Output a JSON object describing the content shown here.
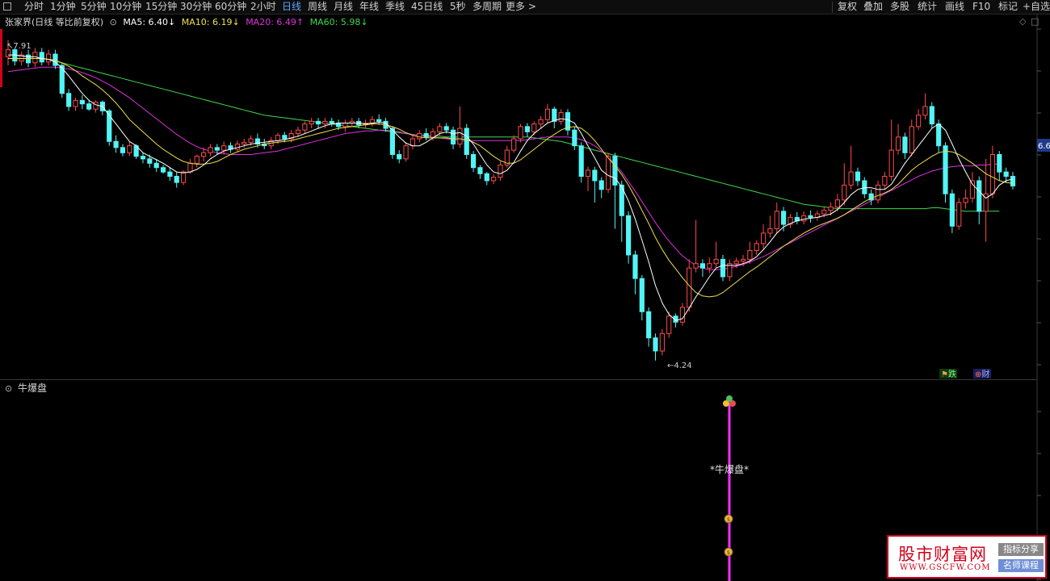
{
  "toolbar": {
    "periods": [
      "分时",
      "1分钟",
      "5分钟",
      "10分钟",
      "15分钟",
      "30分钟",
      "60分钟",
      "2小时",
      "日线",
      "周线",
      "月线",
      "年线",
      "季线",
      "45日线",
      "5秒",
      "多周期",
      "更多 >"
    ],
    "active_period": "日线",
    "right_buttons": [
      "复权",
      "叠加",
      "多股",
      "统计",
      "画线",
      "F10",
      "标记",
      "+自选"
    ]
  },
  "legend": {
    "title": "张家界(日线 等比前复权)",
    "ma5": "MA5: 6.40↓",
    "ma10": "MA10: 6.19↓",
    "ma20": "MA20: 6.49↑",
    "ma60": "MA60: 5.98↓"
  },
  "colors": {
    "up": "#ff4a4a",
    "down": "#52f5f5",
    "ma5": "#ffffff",
    "ma10": "#f0e04a",
    "ma20": "#e030e0",
    "ma60": "#3fd94b",
    "indicator": "#ff2bff"
  },
  "price": {
    "high_label": "7.91",
    "low_label": "4.24",
    "right_label": "6.6"
  },
  "badges": {
    "b1": "跌",
    "b2": "财"
  },
  "indicator": {
    "name": "牛爆盘",
    "signal_label": "*牛爆盘*"
  },
  "watermark": {
    "title": "股市财富网",
    "url": "WWW.GSCFW.COM",
    "tag1": "指标分享",
    "tag2": "名师课程"
  },
  "chart_data": {
    "type": "candlestick",
    "ylim": [
      4.1,
      8.0
    ],
    "candles": [
      [
        7.72,
        7.8,
        7.62,
        7.91
      ],
      [
        7.8,
        7.67,
        7.62,
        7.82
      ],
      [
        7.67,
        7.74,
        7.62,
        7.78
      ],
      [
        7.74,
        7.65,
        7.6,
        7.8
      ],
      [
        7.65,
        7.77,
        7.6,
        7.82
      ],
      [
        7.77,
        7.66,
        7.62,
        7.82
      ],
      [
        7.66,
        7.75,
        7.62,
        7.8
      ],
      [
        7.75,
        7.62,
        7.58,
        7.8
      ],
      [
        7.62,
        7.3,
        7.25,
        7.65
      ],
      [
        7.3,
        7.15,
        7.1,
        7.35
      ],
      [
        7.15,
        7.22,
        7.1,
        7.25
      ],
      [
        7.22,
        7.18,
        7.12,
        7.28
      ],
      [
        7.18,
        7.12,
        7.1,
        7.22
      ],
      [
        7.12,
        7.2,
        7.08,
        7.22
      ],
      [
        7.2,
        7.1,
        7.05,
        7.22
      ],
      [
        7.1,
        6.75,
        6.7,
        7.12
      ],
      [
        6.75,
        6.68,
        6.62,
        6.82
      ],
      [
        6.68,
        6.62,
        6.58,
        6.72
      ],
      [
        6.62,
        6.7,
        6.58,
        6.75
      ],
      [
        6.7,
        6.58,
        6.55,
        6.72
      ],
      [
        6.58,
        6.55,
        6.5,
        6.62
      ],
      [
        6.55,
        6.5,
        6.45,
        6.6
      ],
      [
        6.5,
        6.45,
        6.4,
        6.55
      ],
      [
        6.45,
        6.4,
        6.38,
        6.48
      ],
      [
        6.4,
        6.35,
        6.3,
        6.45
      ],
      [
        6.35,
        6.28,
        6.22,
        6.4
      ],
      [
        6.28,
        6.4,
        6.25,
        6.42
      ],
      [
        6.4,
        6.5,
        6.38,
        6.55
      ],
      [
        6.5,
        6.58,
        6.45,
        6.6
      ],
      [
        6.58,
        6.62,
        6.52,
        6.68
      ],
      [
        6.62,
        6.68,
        6.58,
        6.72
      ],
      [
        6.68,
        6.65,
        6.6,
        6.72
      ],
      [
        6.65,
        6.7,
        6.6,
        6.75
      ],
      [
        6.7,
        6.66,
        6.62,
        6.74
      ],
      [
        6.66,
        6.72,
        6.62,
        6.76
      ],
      [
        6.72,
        6.74,
        6.68,
        6.78
      ],
      [
        6.74,
        6.78,
        6.7,
        6.82
      ],
      [
        6.78,
        6.72,
        6.68,
        6.84
      ],
      [
        6.72,
        6.7,
        6.66,
        6.78
      ],
      [
        6.7,
        6.76,
        6.66,
        6.8
      ],
      [
        6.76,
        6.82,
        6.72,
        6.85
      ],
      [
        6.82,
        6.78,
        6.74,
        6.86
      ],
      [
        6.78,
        6.84,
        6.74,
        6.88
      ],
      [
        6.84,
        6.88,
        6.8,
        6.92
      ],
      [
        6.88,
        6.95,
        6.84,
        6.98
      ],
      [
        6.95,
        6.98,
        6.9,
        7.02
      ],
      [
        6.98,
        6.95,
        6.9,
        7.02
      ],
      [
        6.95,
        6.98,
        6.9,
        7.02
      ],
      [
        6.98,
        6.96,
        6.92,
        7.02
      ],
      [
        6.96,
        6.92,
        6.88,
        7.0
      ],
      [
        6.92,
        6.96,
        6.86,
        7.0
      ],
      [
        6.96,
        6.98,
        6.92,
        7.02
      ],
      [
        6.98,
        6.94,
        6.9,
        7.02
      ],
      [
        6.94,
        6.96,
        6.9,
        7.0
      ],
      [
        6.96,
        7.0,
        6.92,
        7.04
      ],
      [
        7.0,
        6.98,
        6.94,
        7.06
      ],
      [
        6.98,
        6.9,
        6.86,
        7.02
      ],
      [
        6.9,
        6.6,
        6.55,
        6.92
      ],
      [
        6.6,
        6.55,
        6.5,
        6.65
      ],
      [
        6.55,
        6.7,
        6.52,
        6.74
      ],
      [
        6.7,
        6.78,
        6.66,
        6.82
      ],
      [
        6.78,
        6.84,
        6.74,
        6.88
      ],
      [
        6.84,
        6.8,
        6.76,
        6.9
      ],
      [
        6.8,
        6.86,
        6.76,
        6.9
      ],
      [
        6.86,
        6.92,
        6.82,
        6.96
      ],
      [
        6.92,
        6.88,
        6.84,
        6.96
      ],
      [
        6.88,
        6.72,
        6.66,
        6.92
      ],
      [
        6.72,
        6.9,
        6.68,
        7.15
      ],
      [
        6.9,
        6.6,
        6.55,
        6.95
      ],
      [
        6.6,
        6.45,
        6.4,
        6.64
      ],
      [
        6.45,
        6.38,
        6.32,
        6.48
      ],
      [
        6.38,
        6.3,
        6.25,
        6.4
      ],
      [
        6.3,
        6.34,
        6.26,
        6.38
      ],
      [
        6.34,
        6.48,
        6.3,
        6.52
      ],
      [
        6.48,
        6.65,
        6.45,
        6.7
      ],
      [
        6.65,
        6.78,
        6.62,
        6.82
      ],
      [
        6.78,
        6.92,
        6.74,
        6.95
      ],
      [
        6.92,
        6.86,
        6.8,
        6.96
      ],
      [
        6.86,
        6.95,
        6.82,
        6.98
      ],
      [
        6.95,
        7.0,
        6.9,
        7.04
      ],
      [
        7.0,
        7.12,
        6.96,
        7.18
      ],
      [
        7.12,
        6.98,
        6.9,
        7.15
      ],
      [
        6.98,
        7.08,
        6.94,
        7.12
      ],
      [
        7.08,
        6.88,
        6.82,
        7.12
      ],
      [
        6.88,
        6.7,
        6.65,
        6.92
      ],
      [
        6.7,
        6.35,
        6.28,
        6.74
      ],
      [
        6.35,
        6.42,
        6.18,
        6.46
      ],
      [
        6.42,
        6.3,
        6.05,
        6.46
      ],
      [
        6.3,
        6.2,
        6.1,
        6.34
      ],
      [
        6.2,
        6.58,
        6.16,
        6.62
      ],
      [
        6.58,
        6.25,
        5.75,
        6.62
      ],
      [
        6.25,
        5.9,
        5.6,
        6.3
      ],
      [
        5.9,
        5.45,
        5.35,
        5.95
      ],
      [
        5.45,
        5.18,
        5.0,
        5.5
      ],
      [
        5.18,
        4.8,
        4.7,
        5.22
      ],
      [
        4.8,
        4.5,
        4.4,
        4.85
      ],
      [
        4.5,
        4.35,
        4.24,
        4.55
      ],
      [
        4.35,
        4.55,
        4.3,
        4.6
      ],
      [
        4.55,
        4.75,
        4.5,
        4.8
      ],
      [
        4.75,
        4.68,
        4.62,
        4.78
      ],
      [
        4.68,
        4.85,
        4.64,
        4.9
      ],
      [
        4.85,
        5.3,
        4.8,
        5.4
      ],
      [
        5.3,
        5.35,
        5.25,
        5.85
      ],
      [
        5.35,
        5.3,
        5.2,
        5.4
      ],
      [
        5.3,
        5.35,
        5.24,
        5.42
      ],
      [
        5.35,
        5.4,
        5.3,
        5.6
      ],
      [
        5.4,
        5.2,
        5.15,
        5.45
      ],
      [
        5.2,
        5.35,
        5.15,
        5.4
      ],
      [
        5.35,
        5.38,
        5.3,
        5.42
      ],
      [
        5.38,
        5.4,
        5.32,
        5.45
      ],
      [
        5.4,
        5.5,
        5.35,
        5.6
      ],
      [
        5.5,
        5.58,
        5.45,
        5.62
      ],
      [
        5.58,
        5.7,
        5.52,
        5.8
      ],
      [
        5.7,
        5.75,
        5.65,
        5.9
      ],
      [
        5.75,
        5.95,
        5.7,
        6.05
      ],
      [
        5.95,
        5.8,
        5.72,
        6.0
      ],
      [
        5.8,
        5.88,
        5.76,
        5.92
      ],
      [
        5.88,
        5.84,
        5.8,
        5.94
      ],
      [
        5.84,
        5.9,
        5.8,
        5.95
      ],
      [
        5.9,
        5.88,
        5.82,
        5.96
      ],
      [
        5.88,
        5.92,
        5.84,
        5.96
      ],
      [
        5.92,
        5.96,
        5.88,
        6.0
      ],
      [
        5.96,
        6.0,
        5.9,
        6.05
      ],
      [
        6.0,
        6.08,
        5.95,
        6.15
      ],
      [
        6.08,
        6.25,
        6.02,
        6.5
      ],
      [
        6.25,
        6.4,
        6.2,
        6.7
      ],
      [
        6.4,
        6.3,
        6.24,
        6.45
      ],
      [
        6.3,
        6.15,
        6.1,
        6.34
      ],
      [
        6.15,
        6.08,
        6.02,
        6.2
      ],
      [
        6.08,
        6.25,
        6.04,
        6.3
      ],
      [
        6.25,
        6.35,
        6.2,
        6.4
      ],
      [
        6.35,
        6.65,
        6.3,
        7.0
      ],
      [
        6.65,
        6.8,
        6.6,
        6.95
      ],
      [
        6.8,
        6.62,
        6.55,
        6.85
      ],
      [
        6.62,
        6.92,
        6.58,
        7.0
      ],
      [
        6.92,
        7.05,
        6.88,
        7.12
      ],
      [
        7.05,
        7.15,
        7.0,
        7.3
      ],
      [
        7.15,
        6.95,
        6.9,
        7.2
      ],
      [
        6.95,
        6.7,
        6.62,
        7.0
      ],
      [
        6.7,
        6.15,
        6.05,
        6.74
      ],
      [
        6.15,
        5.78,
        5.7,
        6.2
      ],
      [
        5.78,
        6.05,
        5.74,
        6.1
      ],
      [
        6.05,
        6.1,
        5.98,
        6.2
      ],
      [
        6.1,
        6.3,
        6.05,
        6.4
      ],
      [
        6.3,
        5.95,
        5.8,
        6.35
      ],
      [
        5.95,
        6.15,
        5.6,
        6.55
      ],
      [
        6.15,
        6.6,
        6.1,
        6.7
      ],
      [
        6.6,
        6.4,
        6.3,
        6.64
      ],
      [
        6.4,
        6.35,
        6.28,
        6.45
      ],
      [
        6.35,
        6.24,
        6.2,
        6.4
      ]
    ],
    "ma5": [
      7.74,
      7.74,
      7.73,
      7.72,
      7.72,
      7.7,
      7.69,
      7.66,
      7.59,
      7.5,
      7.4,
      7.3,
      7.22,
      7.17,
      7.15,
      7.05,
      6.95,
      6.85,
      6.75,
      6.7,
      6.62,
      6.58,
      6.54,
      6.5,
      6.45,
      6.4,
      6.39,
      6.4,
      6.43,
      6.48,
      6.55,
      6.6,
      6.64,
      6.66,
      6.68,
      6.7,
      6.72,
      6.73,
      6.74,
      6.75,
      6.76,
      6.77,
      6.79,
      6.81,
      6.84,
      6.87,
      6.9,
      6.93,
      6.95,
      6.96,
      6.96,
      6.96,
      6.96,
      6.95,
      6.96,
      6.97,
      6.96,
      6.88,
      6.8,
      6.73,
      6.7,
      6.7,
      6.74,
      6.79,
      6.84,
      6.86,
      6.84,
      6.85,
      6.81,
      6.72,
      6.6,
      6.48,
      6.4,
      6.38,
      6.42,
      6.51,
      6.64,
      6.76,
      6.84,
      6.9,
      6.96,
      6.99,
      7.01,
      7.0,
      6.96,
      6.84,
      6.7,
      6.56,
      6.42,
      6.36,
      6.33,
      6.23,
      6.07,
      5.86,
      5.62,
      5.37,
      5.1,
      4.9,
      4.77,
      4.7,
      4.72,
      4.84,
      4.97,
      5.08,
      5.2,
      5.3,
      5.33,
      5.33,
      5.33,
      5.35,
      5.38,
      5.43,
      5.51,
      5.6,
      5.7,
      5.77,
      5.81,
      5.84,
      5.86,
      5.87,
      5.88,
      5.9,
      5.92,
      5.97,
      6.05,
      6.14,
      6.2,
      6.22,
      6.22,
      6.2,
      6.2,
      6.26,
      6.38,
      6.5,
      6.6,
      6.7,
      6.8,
      6.9,
      6.95,
      6.88,
      6.72,
      6.55,
      6.4,
      6.26,
      6.18,
      6.1,
      6.15,
      6.25,
      6.3,
      6.32
    ],
    "ma10": [
      7.7,
      7.7,
      7.7,
      7.7,
      7.7,
      7.7,
      7.69,
      7.68,
      7.65,
      7.61,
      7.56,
      7.5,
      7.45,
      7.4,
      7.34,
      7.27,
      7.19,
      7.1,
      7.0,
      6.93,
      6.86,
      6.79,
      6.72,
      6.66,
      6.61,
      6.56,
      6.52,
      6.5,
      6.49,
      6.49,
      6.5,
      6.52,
      6.56,
      6.6,
      6.63,
      6.66,
      6.68,
      6.7,
      6.72,
      6.73,
      6.74,
      6.75,
      6.76,
      6.78,
      6.8,
      6.82,
      6.84,
      6.86,
      6.88,
      6.9,
      6.91,
      6.92,
      6.93,
      6.94,
      6.95,
      6.95,
      6.94,
      6.92,
      6.89,
      6.85,
      6.82,
      6.8,
      6.79,
      6.79,
      6.79,
      6.79,
      6.78,
      6.78,
      6.77,
      6.74,
      6.7,
      6.64,
      6.58,
      6.53,
      6.5,
      6.5,
      6.54,
      6.6,
      6.66,
      6.72,
      6.78,
      6.83,
      6.88,
      6.91,
      6.92,
      6.9,
      6.84,
      6.76,
      6.66,
      6.56,
      6.47,
      6.37,
      6.25,
      6.11,
      5.96,
      5.81,
      5.65,
      5.51,
      5.39,
      5.29,
      5.19,
      5.1,
      5.02,
      4.98,
      4.97,
      4.98,
      5.02,
      5.08,
      5.14,
      5.2,
      5.26,
      5.31,
      5.37,
      5.43,
      5.49,
      5.55,
      5.6,
      5.65,
      5.7,
      5.74,
      5.78,
      5.81,
      5.84,
      5.87,
      5.91,
      5.96,
      6.01,
      6.06,
      6.1,
      6.13,
      6.16,
      6.2,
      6.26,
      6.34,
      6.42,
      6.48,
      6.53,
      6.58,
      6.62,
      6.64,
      6.63,
      6.6,
      6.55,
      6.5,
      6.44,
      6.38,
      6.34,
      6.3,
      6.28,
      6.27
    ],
    "ma20": [
      7.55,
      7.56,
      7.57,
      7.58,
      7.59,
      7.6,
      7.6,
      7.6,
      7.59,
      7.58,
      7.56,
      7.54,
      7.51,
      7.48,
      7.44,
      7.4,
      7.35,
      7.3,
      7.25,
      7.19,
      7.13,
      7.07,
      7.01,
      6.95,
      6.89,
      6.83,
      6.78,
      6.73,
      6.69,
      6.66,
      6.64,
      6.62,
      6.61,
      6.6,
      6.6,
      6.6,
      6.6,
      6.61,
      6.62,
      6.63,
      6.64,
      6.66,
      6.68,
      6.7,
      6.72,
      6.74,
      6.76,
      6.78,
      6.8,
      6.82,
      6.84,
      6.85,
      6.86,
      6.87,
      6.87,
      6.88,
      6.88,
      6.87,
      6.86,
      6.84,
      6.83,
      6.82,
      6.81,
      6.8,
      6.79,
      6.78,
      6.77,
      6.76,
      6.76,
      6.76,
      6.76,
      6.76,
      6.76,
      6.76,
      6.76,
      6.76,
      6.76,
      6.77,
      6.78,
      6.79,
      6.8,
      6.8,
      6.8,
      6.8,
      6.79,
      6.77,
      6.74,
      6.7,
      6.64,
      6.57,
      6.49,
      6.4,
      6.29,
      6.18,
      6.06,
      5.94,
      5.82,
      5.71,
      5.61,
      5.52,
      5.44,
      5.38,
      5.33,
      5.3,
      5.28,
      5.28,
      5.29,
      5.3,
      5.32,
      5.34,
      5.37,
      5.4,
      5.43,
      5.47,
      5.51,
      5.55,
      5.59,
      5.63,
      5.67,
      5.71,
      5.75,
      5.79,
      5.83,
      5.87,
      5.91,
      5.95,
      5.99,
      6.03,
      6.07,
      6.11,
      6.15,
      6.19,
      6.23,
      6.27,
      6.31,
      6.35,
      6.38,
      6.41,
      6.43,
      6.45,
      6.46,
      6.47,
      6.47,
      6.47,
      6.48,
      6.48,
      6.49,
      6.49
    ],
    "ma60": [
      7.74,
      7.74,
      7.73,
      7.72,
      7.71,
      7.7,
      7.69,
      7.67,
      7.65,
      7.63,
      7.61,
      7.59,
      7.57,
      7.55,
      7.53,
      7.51,
      7.49,
      7.47,
      7.45,
      7.43,
      7.41,
      7.39,
      7.37,
      7.35,
      7.33,
      7.31,
      7.29,
      7.27,
      7.25,
      7.23,
      7.21,
      7.19,
      7.17,
      7.15,
      7.13,
      7.11,
      7.09,
      7.07,
      7.05,
      7.04,
      7.03,
      7.02,
      7.01,
      7.0,
      6.99,
      6.98,
      6.97,
      6.96,
      6.95,
      6.94,
      6.93,
      6.92,
      6.91,
      6.9,
      6.89,
      6.88,
      6.87,
      6.86,
      6.85,
      6.84,
      6.83,
      6.82,
      6.82,
      6.81,
      6.81,
      6.8,
      6.8,
      6.8,
      6.8,
      6.8,
      6.8,
      6.8,
      6.8,
      6.8,
      6.8,
      6.8,
      6.8,
      6.8,
      6.79,
      6.78,
      6.77,
      6.76,
      6.75,
      6.73,
      6.71,
      6.69,
      6.67,
      6.65,
      6.63,
      6.61,
      6.59,
      6.57,
      6.55,
      6.53,
      6.51,
      6.49,
      6.47,
      6.45,
      6.43,
      6.41,
      6.39,
      6.37,
      6.35,
      6.33,
      6.31,
      6.29,
      6.27,
      6.25,
      6.23,
      6.21,
      6.19,
      6.17,
      6.15,
      6.13,
      6.11,
      6.09,
      6.07,
      6.05,
      6.03,
      6.02,
      6.01,
      6.0,
      5.99,
      5.98,
      5.98,
      5.98,
      5.98,
      5.98,
      5.98,
      5.98,
      5.98,
      5.98,
      5.98,
      5.98,
      5.98,
      5.98,
      5.98,
      5.99,
      5.99,
      5.98,
      5.97,
      5.96,
      5.95,
      5.95,
      5.95,
      5.95,
      5.95,
      5.95
    ]
  }
}
